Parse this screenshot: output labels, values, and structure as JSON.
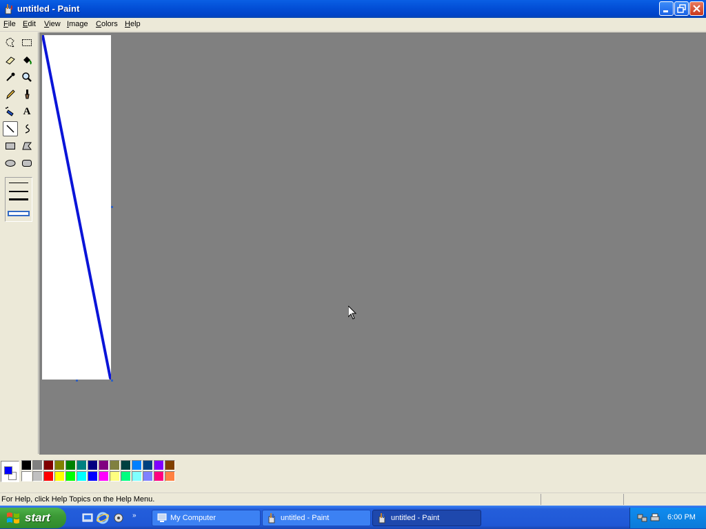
{
  "window": {
    "title": "untitled - Paint",
    "controls": [
      "minimize",
      "restore",
      "close"
    ]
  },
  "menu": [
    {
      "label": "File",
      "mnemonic": "F",
      "rest": "ile"
    },
    {
      "label": "Edit",
      "mnemonic": "E",
      "rest": "dit"
    },
    {
      "label": "View",
      "mnemonic": "V",
      "rest": "iew"
    },
    {
      "label": "Image",
      "mnemonic": "I",
      "rest": "mage"
    },
    {
      "label": "Colors",
      "mnemonic": "C",
      "rest": "olors"
    },
    {
      "label": "Help",
      "mnemonic": "H",
      "rest": "elp"
    }
  ],
  "toolbox": {
    "selected_tool": "line",
    "tools": [
      "free-form-select",
      "select",
      "eraser",
      "fill-with-color",
      "pick-color",
      "magnifier",
      "pencil",
      "brush",
      "airbrush",
      "text",
      "line",
      "curve",
      "rectangle",
      "polygon",
      "ellipse",
      "rounded-rectangle"
    ],
    "line_widths": 4,
    "text_tool_glyph": "A"
  },
  "canvas": {
    "background": "#ffffff",
    "stroke_color": "#0000ff"
  },
  "colors": {
    "foreground": "#0000ff",
    "background": "#ffffff",
    "palette_top": [
      "#000000",
      "#808080",
      "#800000",
      "#808000",
      "#008000",
      "#008080",
      "#000080",
      "#800080",
      "#808040",
      "#004040",
      "#0080ff",
      "#004080",
      "#8000ff",
      "#804000"
    ],
    "palette_bottom": [
      "#ffffff",
      "#c0c0c0",
      "#ff0000",
      "#ffff00",
      "#00ff00",
      "#00ffff",
      "#0000ff",
      "#ff00ff",
      "#ffff80",
      "#00ff80",
      "#80ffff",
      "#8080ff",
      "#ff0080",
      "#ff8040"
    ]
  },
  "status": {
    "text": "For Help, click Help Topics on the Help Menu."
  },
  "taskbar": {
    "start_label": "start",
    "tasks": [
      {
        "label": "My Computer",
        "icon": "computer-icon",
        "active": false
      },
      {
        "label": "untitled - Paint",
        "icon": "paint-icon",
        "active": false
      },
      {
        "label": "untitled - Paint",
        "icon": "paint-icon",
        "active": true
      }
    ],
    "clock": "6:00 PM"
  }
}
